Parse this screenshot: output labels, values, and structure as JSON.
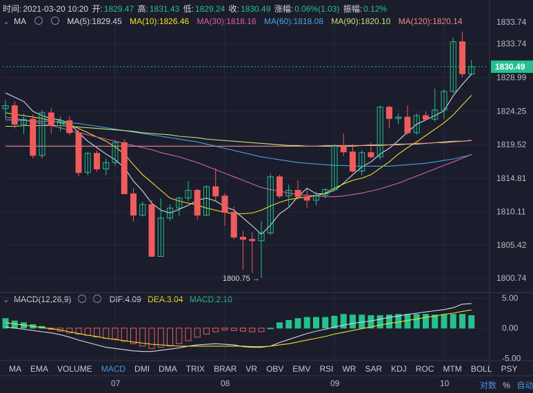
{
  "ohlc_bar": {
    "time_label": "时间:",
    "time_value": "2021-03-20 10:20",
    "open_label": "开:",
    "open_value": "1829.47",
    "high_label": "高:",
    "high_value": "1831.43",
    "low_label": "低:",
    "low_value": "1829.24",
    "close_label": "收:",
    "close_value": "1830.49",
    "chg_label": "涨幅:",
    "chg_value": "0.06%(1.03)",
    "amp_label": "振幅:",
    "amp_value": "0.12%"
  },
  "ma_legend": {
    "name": "MA",
    "items": [
      {
        "text": "MA(5):1829.45",
        "color": "#d8dbe6"
      },
      {
        "text": "MA(10):1826.46",
        "color": "#f2e124"
      },
      {
        "text": "MA(30):1818.16",
        "color": "#d95fb0"
      },
      {
        "text": "MA(60):1818.08",
        "color": "#4aa3df"
      },
      {
        "text": "MA(90):1820.10",
        "color": "#c8e07a"
      },
      {
        "text": "MA(120):1820.14",
        "color": "#f08a8a"
      }
    ]
  },
  "macd_legend": {
    "name": "MACD(12,26,9)",
    "dif": "DIF:4.09",
    "dea": "DEA:3.04",
    "macd": "MACD:2.10"
  },
  "indicators": [
    "MA",
    "EMA",
    "VOLUME",
    "MACD",
    "DMI",
    "DMA",
    "TRIX",
    "BRAR",
    "VR",
    "OBV",
    "EMV",
    "RSI",
    "WR",
    "SAR",
    "KDJ",
    "ROC",
    "MTM",
    "BOLL",
    "PSY"
  ],
  "active_indicator": "MACD",
  "bottom_controls": {
    "log": "对数",
    "percent": "%",
    "auto": "自动"
  },
  "price_callouts": {
    "min_label": "1800.75 →",
    "max_label": "1833.74",
    "current_price": "1830.49"
  },
  "colors": {
    "up": "#26c08e",
    "down": "#ef5c5c",
    "bg": "#1b1d2c",
    "grid": "#262a3d",
    "active": "#4a90e2"
  },
  "chart_data": [
    {
      "type": "candlestick",
      "title": "",
      "ylim": [
        1799.2,
        1836.0
      ],
      "y_ticks": [
        1833.74,
        1828.99,
        1824.25,
        1819.52,
        1814.81,
        1810.11,
        1805.42,
        1800.74
      ],
      "x_ticks": [
        {
          "label": "07",
          "index": 12
        },
        {
          "label": "08",
          "index": 24
        },
        {
          "label": "09",
          "index": 36
        },
        {
          "label": "10",
          "index": 48
        }
      ],
      "candles": [
        [
          1824.6,
          1825.8,
          1823.1,
          1825.0
        ],
        [
          1825.0,
          1825.6,
          1821.8,
          1822.4
        ],
        [
          1822.4,
          1823.9,
          1821.0,
          1823.1
        ],
        [
          1823.1,
          1823.8,
          1817.6,
          1818.0
        ],
        [
          1818.0,
          1824.4,
          1817.6,
          1824.0
        ],
        [
          1824.0,
          1824.7,
          1821.1,
          1822.2
        ],
        [
          1822.2,
          1823.5,
          1821.4,
          1822.9
        ],
        [
          1822.9,
          1823.5,
          1820.9,
          1821.2
        ],
        [
          1821.2,
          1821.8,
          1815.1,
          1815.6
        ],
        [
          1815.6,
          1818.5,
          1815.2,
          1818.3
        ],
        [
          1818.3,
          1818.7,
          1815.7,
          1816.1
        ],
        [
          1816.1,
          1817.6,
          1815.2,
          1817.0
        ],
        [
          1817.0,
          1820.1,
          1816.5,
          1819.8
        ],
        [
          1819.8,
          1820.3,
          1812.6,
          1812.6
        ],
        [
          1812.6,
          1813.4,
          1808.7,
          1809.6
        ],
        [
          1809.6,
          1811.5,
          1809.4,
          1811.1
        ],
        [
          1811.1,
          1811.7,
          1803.8,
          1803.8
        ],
        [
          1803.8,
          1812.0,
          1803.8,
          1809.2
        ],
        [
          1809.2,
          1811.1,
          1808.8,
          1810.6
        ],
        [
          1810.6,
          1812.2,
          1809.5,
          1812.0
        ],
        [
          1812.0,
          1814.4,
          1811.6,
          1813.1
        ],
        [
          1813.1,
          1813.3,
          1809.0,
          1809.6
        ],
        [
          1809.6,
          1813.8,
          1809.5,
          1813.6
        ],
        [
          1813.6,
          1816.2,
          1811.6,
          1812.3
        ],
        [
          1812.3,
          1812.7,
          1808.1,
          1810.0
        ],
        [
          1810.0,
          1810.8,
          1806.2,
          1806.5
        ],
        [
          1806.5,
          1807.4,
          1801.9,
          1806.2
        ],
        [
          1806.2,
          1807.2,
          1801.5,
          1806.0
        ],
        [
          1806.0,
          1808.8,
          1800.75,
          1807.1
        ],
        [
          1807.1,
          1815.4,
          1806.8,
          1815.0
        ],
        [
          1815.0,
          1815.3,
          1812.0,
          1812.3
        ],
        [
          1812.3,
          1813.9,
          1810.6,
          1813.1
        ],
        [
          1813.1,
          1814.5,
          1811.8,
          1812.2
        ],
        [
          1812.2,
          1813.4,
          1810.6,
          1811.7
        ],
        [
          1811.7,
          1812.9,
          1811.0,
          1812.4
        ],
        [
          1812.4,
          1813.4,
          1812.0,
          1813.2
        ],
        [
          1813.2,
          1819.6,
          1813.0,
          1819.3
        ],
        [
          1819.3,
          1821.1,
          1817.9,
          1818.5
        ],
        [
          1818.5,
          1819.6,
          1815.6,
          1815.8
        ],
        [
          1815.8,
          1818.7,
          1815.2,
          1818.4
        ],
        [
          1818.4,
          1819.8,
          1817.6,
          1817.8
        ],
        [
          1817.8,
          1825.0,
          1817.4,
          1824.8
        ],
        [
          1824.8,
          1825.0,
          1821.8,
          1823.2
        ],
        [
          1823.2,
          1823.9,
          1822.4,
          1823.4
        ],
        [
          1823.4,
          1825.0,
          1820.9,
          1821.2
        ],
        [
          1821.2,
          1823.9,
          1820.9,
          1823.6
        ],
        [
          1823.6,
          1824.2,
          1822.9,
          1823.1
        ],
        [
          1823.1,
          1827.4,
          1822.8,
          1824.4
        ],
        [
          1824.4,
          1827.3,
          1823.1,
          1827.0
        ],
        [
          1827.0,
          1834.6,
          1826.8,
          1834.0
        ],
        [
          1834.0,
          1835.4,
          1829.0,
          1829.5
        ],
        [
          1829.47,
          1831.43,
          1829.24,
          1830.49
        ]
      ],
      "ma_series": [
        {
          "name": "MA(5)",
          "color": "#d8dbe6",
          "values": [
            1826.8,
            1826.2,
            1825.6,
            1824.2,
            1823.6,
            1823.2,
            1823.0,
            1822.5,
            1821.2,
            1820.0,
            1819.1,
            1818.2,
            1817.4,
            1816.3,
            1814.4,
            1813.0,
            1811.3,
            1810.3,
            1809.9,
            1810.4,
            1811.0,
            1811.7,
            1812.0,
            1811.6,
            1810.8,
            1810.3,
            1809.2,
            1808.1,
            1806.9,
            1808.2,
            1809.8,
            1810.7,
            1812.2,
            1813.4,
            1812.6,
            1812.6,
            1813.1,
            1814.1,
            1815.3,
            1816.4,
            1817.1,
            1818.2,
            1819.0,
            1820.1,
            1821.3,
            1822.4,
            1823.0,
            1823.6,
            1824.3,
            1826.4,
            1828.0,
            1829.45
          ]
        },
        {
          "name": "MA(10)",
          "color": "#f2e124",
          "values": [
            1824.0,
            1823.8,
            1823.6,
            1823.4,
            1823.2,
            1822.9,
            1822.6,
            1822.3,
            1821.8,
            1821.2,
            1820.6,
            1820.0,
            1819.2,
            1818.2,
            1816.7,
            1815.3,
            1814.2,
            1813.1,
            1812.0,
            1811.6,
            1811.3,
            1811.0,
            1810.6,
            1810.3,
            1810.0,
            1809.8,
            1809.8,
            1809.9,
            1810.3,
            1810.9,
            1811.4,
            1811.8,
            1812.0,
            1812.2,
            1812.3,
            1812.7,
            1813.4,
            1814.0,
            1814.5,
            1814.8,
            1815.3,
            1816.2,
            1817.1,
            1818.2,
            1819.1,
            1819.9,
            1820.8,
            1821.7,
            1822.6,
            1823.7,
            1825.1,
            1826.46
          ]
        },
        {
          "name": "MA(30)",
          "color": "#d95fb0",
          "values": [
            1823.4,
            1823.2,
            1823.0,
            1822.7,
            1822.5,
            1822.2,
            1821.9,
            1821.5,
            1821.2,
            1820.9,
            1820.6,
            1820.3,
            1820.0,
            1819.7,
            1819.4,
            1819.1,
            1818.8,
            1818.4,
            1818.1,
            1817.8,
            1817.4,
            1817.0,
            1816.5,
            1816.0,
            1815.5,
            1815.0,
            1814.5,
            1814.0,
            1813.5,
            1813.2,
            1813.0,
            1812.7,
            1812.5,
            1812.4,
            1812.3,
            1812.2,
            1812.2,
            1812.3,
            1812.5,
            1812.7,
            1813.0,
            1813.3,
            1813.7,
            1814.1,
            1814.6,
            1815.1,
            1815.6,
            1816.1,
            1816.6,
            1817.1,
            1817.6,
            1818.16
          ]
        },
        {
          "name": "MA(60)",
          "color": "#4aa3df",
          "values": [
            1823.0,
            1823.0,
            1822.9,
            1822.9,
            1822.8,
            1822.8,
            1822.7,
            1822.6,
            1822.5,
            1822.3,
            1822.1,
            1821.9,
            1821.7,
            1821.5,
            1821.3,
            1821.1,
            1820.9,
            1820.7,
            1820.5,
            1820.3,
            1820.1,
            1819.9,
            1819.6,
            1819.3,
            1819.0,
            1818.7,
            1818.4,
            1818.1,
            1817.8,
            1817.6,
            1817.4,
            1817.2,
            1817.0,
            1816.9,
            1816.8,
            1816.7,
            1816.6,
            1816.6,
            1816.5,
            1816.5,
            1816.5,
            1816.5,
            1816.5,
            1816.6,
            1816.7,
            1816.8,
            1816.9,
            1817.1,
            1817.3,
            1817.5,
            1817.8,
            1818.08
          ]
        },
        {
          "name": "MA(90)",
          "color": "#c8e07a",
          "values": [
            1822.1,
            1822.1,
            1822.2,
            1822.2,
            1822.2,
            1822.2,
            1822.2,
            1822.1,
            1822.0,
            1821.9,
            1821.8,
            1821.7,
            1821.6,
            1821.5,
            1821.4,
            1821.2,
            1821.1,
            1821.0,
            1820.9,
            1820.7,
            1820.6,
            1820.5,
            1820.3,
            1820.2,
            1820.1,
            1820.0,
            1819.9,
            1819.8,
            1819.7,
            1819.6,
            1819.5,
            1819.4,
            1819.4,
            1819.3,
            1819.3,
            1819.3,
            1819.3,
            1819.3,
            1819.3,
            1819.4,
            1819.4,
            1819.4,
            1819.5,
            1819.5,
            1819.6,
            1819.6,
            1819.7,
            1819.8,
            1819.9,
            1820.0,
            1820.0,
            1820.1
          ]
        },
        {
          "name": "MA(120)",
          "color": "#f08a8a",
          "values": [
            1819.3,
            1819.3,
            1819.3,
            1819.3,
            1819.3,
            1819.3,
            1819.3,
            1819.3,
            1819.3,
            1819.3,
            1819.3,
            1819.3,
            1819.3,
            1819.3,
            1819.3,
            1819.3,
            1819.3,
            1819.3,
            1819.3,
            1819.3,
            1819.3,
            1819.3,
            1819.3,
            1819.3,
            1819.3,
            1819.3,
            1819.3,
            1819.3,
            1819.3,
            1819.3,
            1819.3,
            1819.3,
            1819.3,
            1819.3,
            1819.3,
            1819.4,
            1819.4,
            1819.4,
            1819.4,
            1819.4,
            1819.5,
            1819.5,
            1819.5,
            1819.6,
            1819.6,
            1819.7,
            1819.7,
            1819.8,
            1819.8,
            1819.9,
            1820.0,
            1820.14
          ]
        }
      ]
    },
    {
      "type": "bar",
      "title": "MACD(12,26,9)",
      "ylim": [
        -5.2,
        5.6
      ],
      "y_ticks": [
        5.0,
        0.0,
        -5.0
      ],
      "macd": [
        1.6,
        1.2,
        0.9,
        0.6,
        0.3,
        -0.2,
        -0.5,
        -0.8,
        -1.0,
        -1.2,
        -1.5,
        -1.7,
        -1.8,
        -2.2,
        -2.6,
        -3.0,
        -3.4,
        -3.2,
        -3.0,
        -2.6,
        -2.1,
        -1.5,
        -1.0,
        -0.6,
        -0.3,
        -0.4,
        -0.5,
        -0.6,
        -0.6,
        0.0,
        0.9,
        1.3,
        1.6,
        1.8,
        1.8,
        1.8,
        2.0,
        2.3,
        2.2,
        2.2,
        2.1,
        2.1,
        2.2,
        2.3,
        2.3,
        2.3,
        2.3,
        2.2,
        2.2,
        2.3,
        2.3,
        2.1
      ],
      "dif": [
        0.2,
        0.0,
        -0.2,
        -0.4,
        -0.6,
        -0.8,
        -1.1,
        -1.5,
        -2.0,
        -2.4,
        -2.8,
        -3.2,
        -3.4,
        -3.6,
        -3.8,
        -3.9,
        -3.9,
        -3.7,
        -3.5,
        -3.3,
        -3.0,
        -2.8,
        -2.7,
        -2.6,
        -2.7,
        -2.8,
        -3.1,
        -3.2,
        -3.2,
        -3.0,
        -2.4,
        -1.9,
        -1.4,
        -0.9,
        -0.5,
        -0.2,
        0.2,
        0.5,
        0.8,
        1.0,
        1.2,
        1.5,
        1.8,
        2.0,
        2.3,
        2.5,
        2.7,
        2.9,
        3.1,
        3.4,
        4.0,
        4.09
      ],
      "dea": [
        0.9,
        0.7,
        0.5,
        0.3,
        0.1,
        -0.1,
        -0.3,
        -0.6,
        -0.9,
        -1.2,
        -1.4,
        -1.7,
        -1.9,
        -2.1,
        -2.3,
        -2.5,
        -2.7,
        -2.8,
        -2.9,
        -3.0,
        -3.0,
        -3.0,
        -3.0,
        -3.0,
        -3.0,
        -3.0,
        -3.0,
        -3.1,
        -3.1,
        -3.0,
        -2.8,
        -2.6,
        -2.3,
        -2.0,
        -1.7,
        -1.4,
        -1.0,
        -0.7,
        -0.4,
        -0.1,
        0.2,
        0.5,
        0.8,
        1.0,
        1.3,
        1.5,
        1.8,
        2.0,
        2.3,
        2.5,
        2.8,
        3.04
      ]
    }
  ]
}
